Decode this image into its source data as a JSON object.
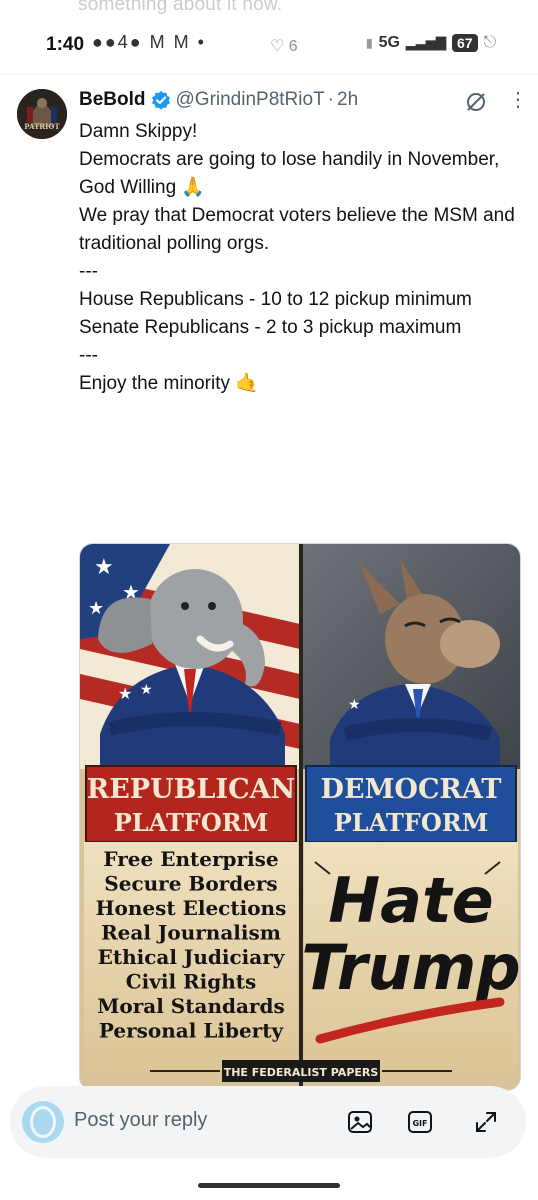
{
  "previous_post": {
    "fragment_text": "something about it now."
  },
  "status_bar": {
    "time": "1:40",
    "notification_icons": "●●4● M M •",
    "likes_count": "6",
    "network": "5G",
    "battery": "67"
  },
  "post": {
    "display_name": "BeBold",
    "handle": "@GrindinP8tRioT",
    "separator": "·",
    "timestamp": "2h",
    "avatar_text": "PATRIOT",
    "paragraphs": [
      "Damn Skippy!",
      "",
      "Democrats are going to lose handily in November, God Willing 🙏",
      "",
      "We pray that Democrat voters believe the MSM and traditional polling orgs.",
      "---",
      "",
      "House Republicans - 10 to 12 pickup minimum",
      "",
      "Senate Republicans - 2 to 3 pickup maximum",
      "---",
      "",
      "Enjoy the minority 🤙"
    ],
    "media": {
      "left_banner_top": "REPUBLICAN",
      "left_banner_bottom": "PLATFORM",
      "right_banner_top": "DEMOCRAT",
      "right_banner_bottom": "PLATFORM",
      "left_list": [
        "Free Enterprise",
        "Secure Borders",
        "Honest Elections",
        "Real Journalism",
        "Ethical Judiciary",
        "Civil Rights",
        "Moral Standards",
        "Personal Liberty"
      ],
      "right_big_text_1": "Hate",
      "right_big_text_2": "Trump",
      "footer_credit": "THE FEDERALIST PAPERS"
    }
  },
  "reply_bar": {
    "placeholder": "Post your reply",
    "gif_label": "GIF"
  },
  "colors": {
    "verified_blue": "#1d9bf0",
    "republican_red": "#b3261e",
    "democrat_blue": "#1f4f9c",
    "parchment": "#ead9b5"
  }
}
